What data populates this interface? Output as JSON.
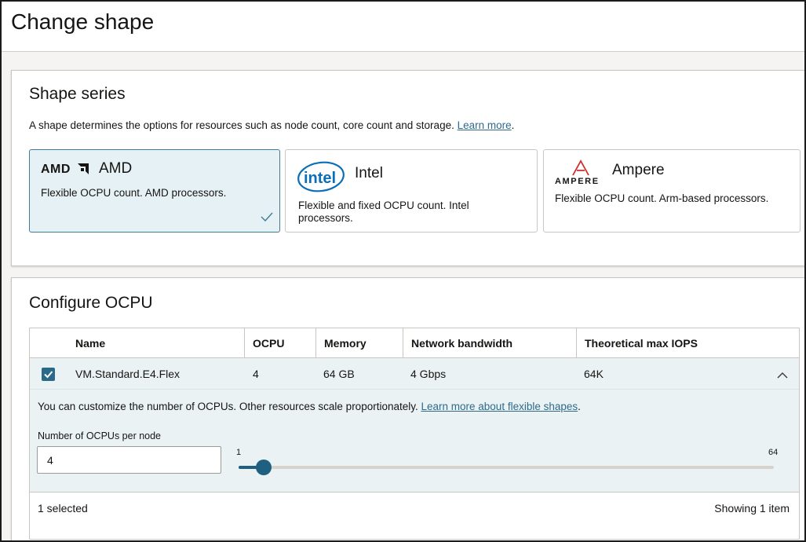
{
  "header": {
    "title": "Change shape"
  },
  "shape_series": {
    "title": "Shape series",
    "description": "A shape determines the options for resources such as node count, core count and storage.",
    "learn_more": "Learn more",
    "cards": [
      {
        "logo_text": "AMDA",
        "name": "AMD",
        "description": "Flexible OCPU count. AMD processors.",
        "selected": true,
        "logo": "amd-logo"
      },
      {
        "logo_text": "intel",
        "name": "Intel",
        "description": "Flexible and fixed OCPU count. Intel processors.",
        "selected": false,
        "logo": "intel-logo"
      },
      {
        "logo_text": "AMPERE",
        "name": "Ampere",
        "description": "Flexible OCPU count. Arm-based processors.",
        "selected": false,
        "logo": "ampere-logo"
      }
    ]
  },
  "configure": {
    "title": "Configure OCPU",
    "columns": [
      "Name",
      "OCPU",
      "Memory",
      "Network bandwidth",
      "Theoretical max IOPS"
    ],
    "row": {
      "name": "VM.Standard.E4.Flex",
      "ocpu": "4",
      "memory": "64 GB",
      "network": "4 Gbps",
      "iops": "64K",
      "checked": true
    },
    "detail": {
      "info": "You can customize the number of OCPUs. Other resources scale proportionately.",
      "learn_more": "Learn more about flexible shapes",
      "field_label": "Number of OCPUs per node",
      "field_value": "4",
      "slider_min": "1",
      "slider_max": "64",
      "slider_value": 4
    },
    "footer": {
      "selected": "1 selected",
      "showing": "Showing 1 item"
    }
  },
  "colors": {
    "accent": "#1f5f7f",
    "selected_card_bg": "#e6f1f5",
    "link": "#2f6a8a",
    "row_highlight": "#eaf2f4"
  }
}
